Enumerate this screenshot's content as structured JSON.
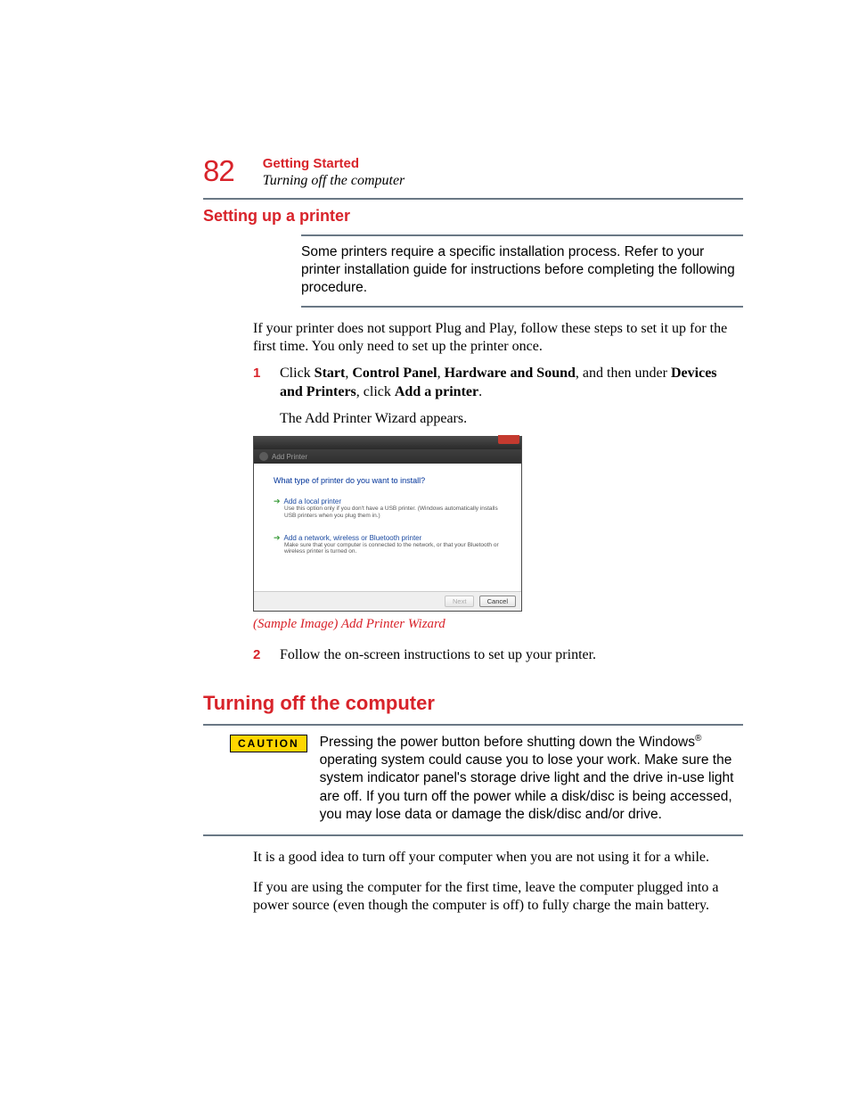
{
  "page_number": "82",
  "header": {
    "chapter": "Getting Started",
    "section": "Turning off the computer"
  },
  "section1": {
    "title": "Setting up a printer",
    "note": "Some printers require a specific installation process. Refer to your printer installation guide for instructions before completing the following procedure.",
    "intro": "If your printer does not support Plug and Play, follow these steps to set it up for the first time. You only need to set up the printer once.",
    "step1_num": "1",
    "step1_prefix": "Click ",
    "step1_b1": "Start",
    "step1_sep": ", ",
    "step1_b2": "Control Panel",
    "step1_b3": "Hardware and Sound",
    "step1_mid": ", and then under ",
    "step1_b4": "Devices and Printers",
    "step1_mid2": ", click ",
    "step1_b5": "Add a printer",
    "step1_end": ".",
    "step1_result": "The Add Printer Wizard appears.",
    "caption": "(Sample Image) Add Printer Wizard",
    "step2_num": "2",
    "step2": "Follow the on-screen instructions to set up your printer."
  },
  "wizard": {
    "crumb": "Add Printer",
    "question": "What type of printer do you want to install?",
    "opt1_title": "Add a local printer",
    "opt1_desc": "Use this option only if you don't have a USB printer. (Windows automatically installs USB printers when you plug them in.)",
    "opt2_title": "Add a network, wireless or Bluetooth printer",
    "opt2_desc": "Make sure that your computer is connected to the network, or that your Bluetooth or wireless printer is turned on.",
    "btn_next": "Next",
    "btn_cancel": "Cancel"
  },
  "section2": {
    "title": "Turning off the computer",
    "caution_label": "CAUTION",
    "caution_text_a": "Pressing the power button before shutting down the Windows",
    "caution_text_b": " operating system could cause you to lose your work. Make sure the system indicator panel's storage drive light and the drive in-use light are off. If you turn off the power while a disk/disc is being accessed, you may lose data or damage the disk/disc and/or drive.",
    "p1": "It is a good idea to turn off your computer when you are not using it for a while.",
    "p2": "If you are using the computer for the first time, leave the computer plugged into a power source (even though the computer is off) to fully charge the main battery."
  }
}
